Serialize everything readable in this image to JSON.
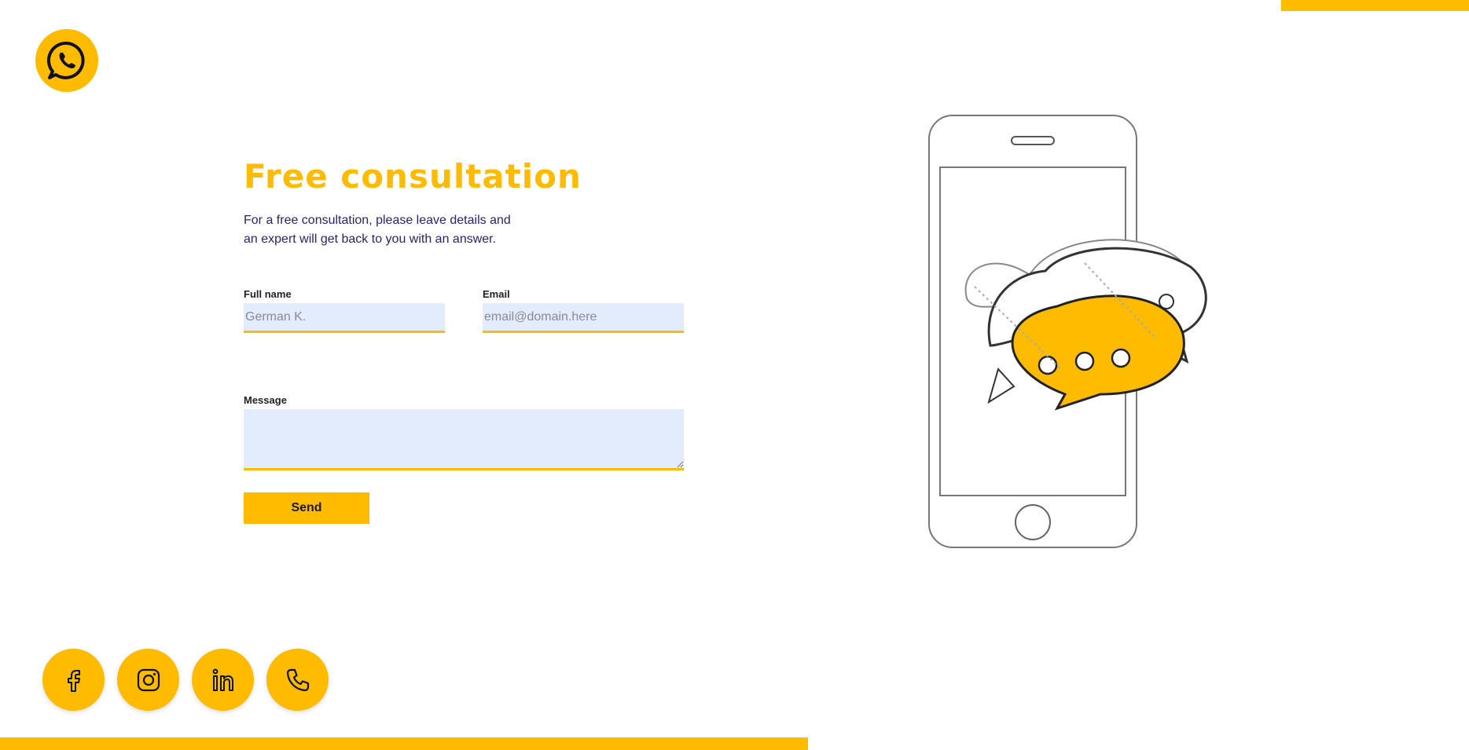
{
  "brand": {
    "accent": "#ffbb00",
    "input_bg": "#e3ecfd",
    "logo_icon": "whatsapp-icon"
  },
  "form": {
    "title": "Free consultation",
    "intro": "For a free consultation, please leave details and an expert will get back to you with an answer.",
    "fullname_label": "Full name",
    "fullname_placeholder": "German K.",
    "email_label": "Email",
    "email_placeholder": "email@domain.here",
    "message_label": "Message",
    "message_value": "",
    "send_label": "Send"
  },
  "illustration": {
    "icon": "phone-chat-bubbles-illustration"
  },
  "socials": [
    {
      "icon": "facebook-icon"
    },
    {
      "icon": "instagram-icon"
    },
    {
      "icon": "linkedin-icon"
    },
    {
      "icon": "phone-icon"
    }
  ]
}
